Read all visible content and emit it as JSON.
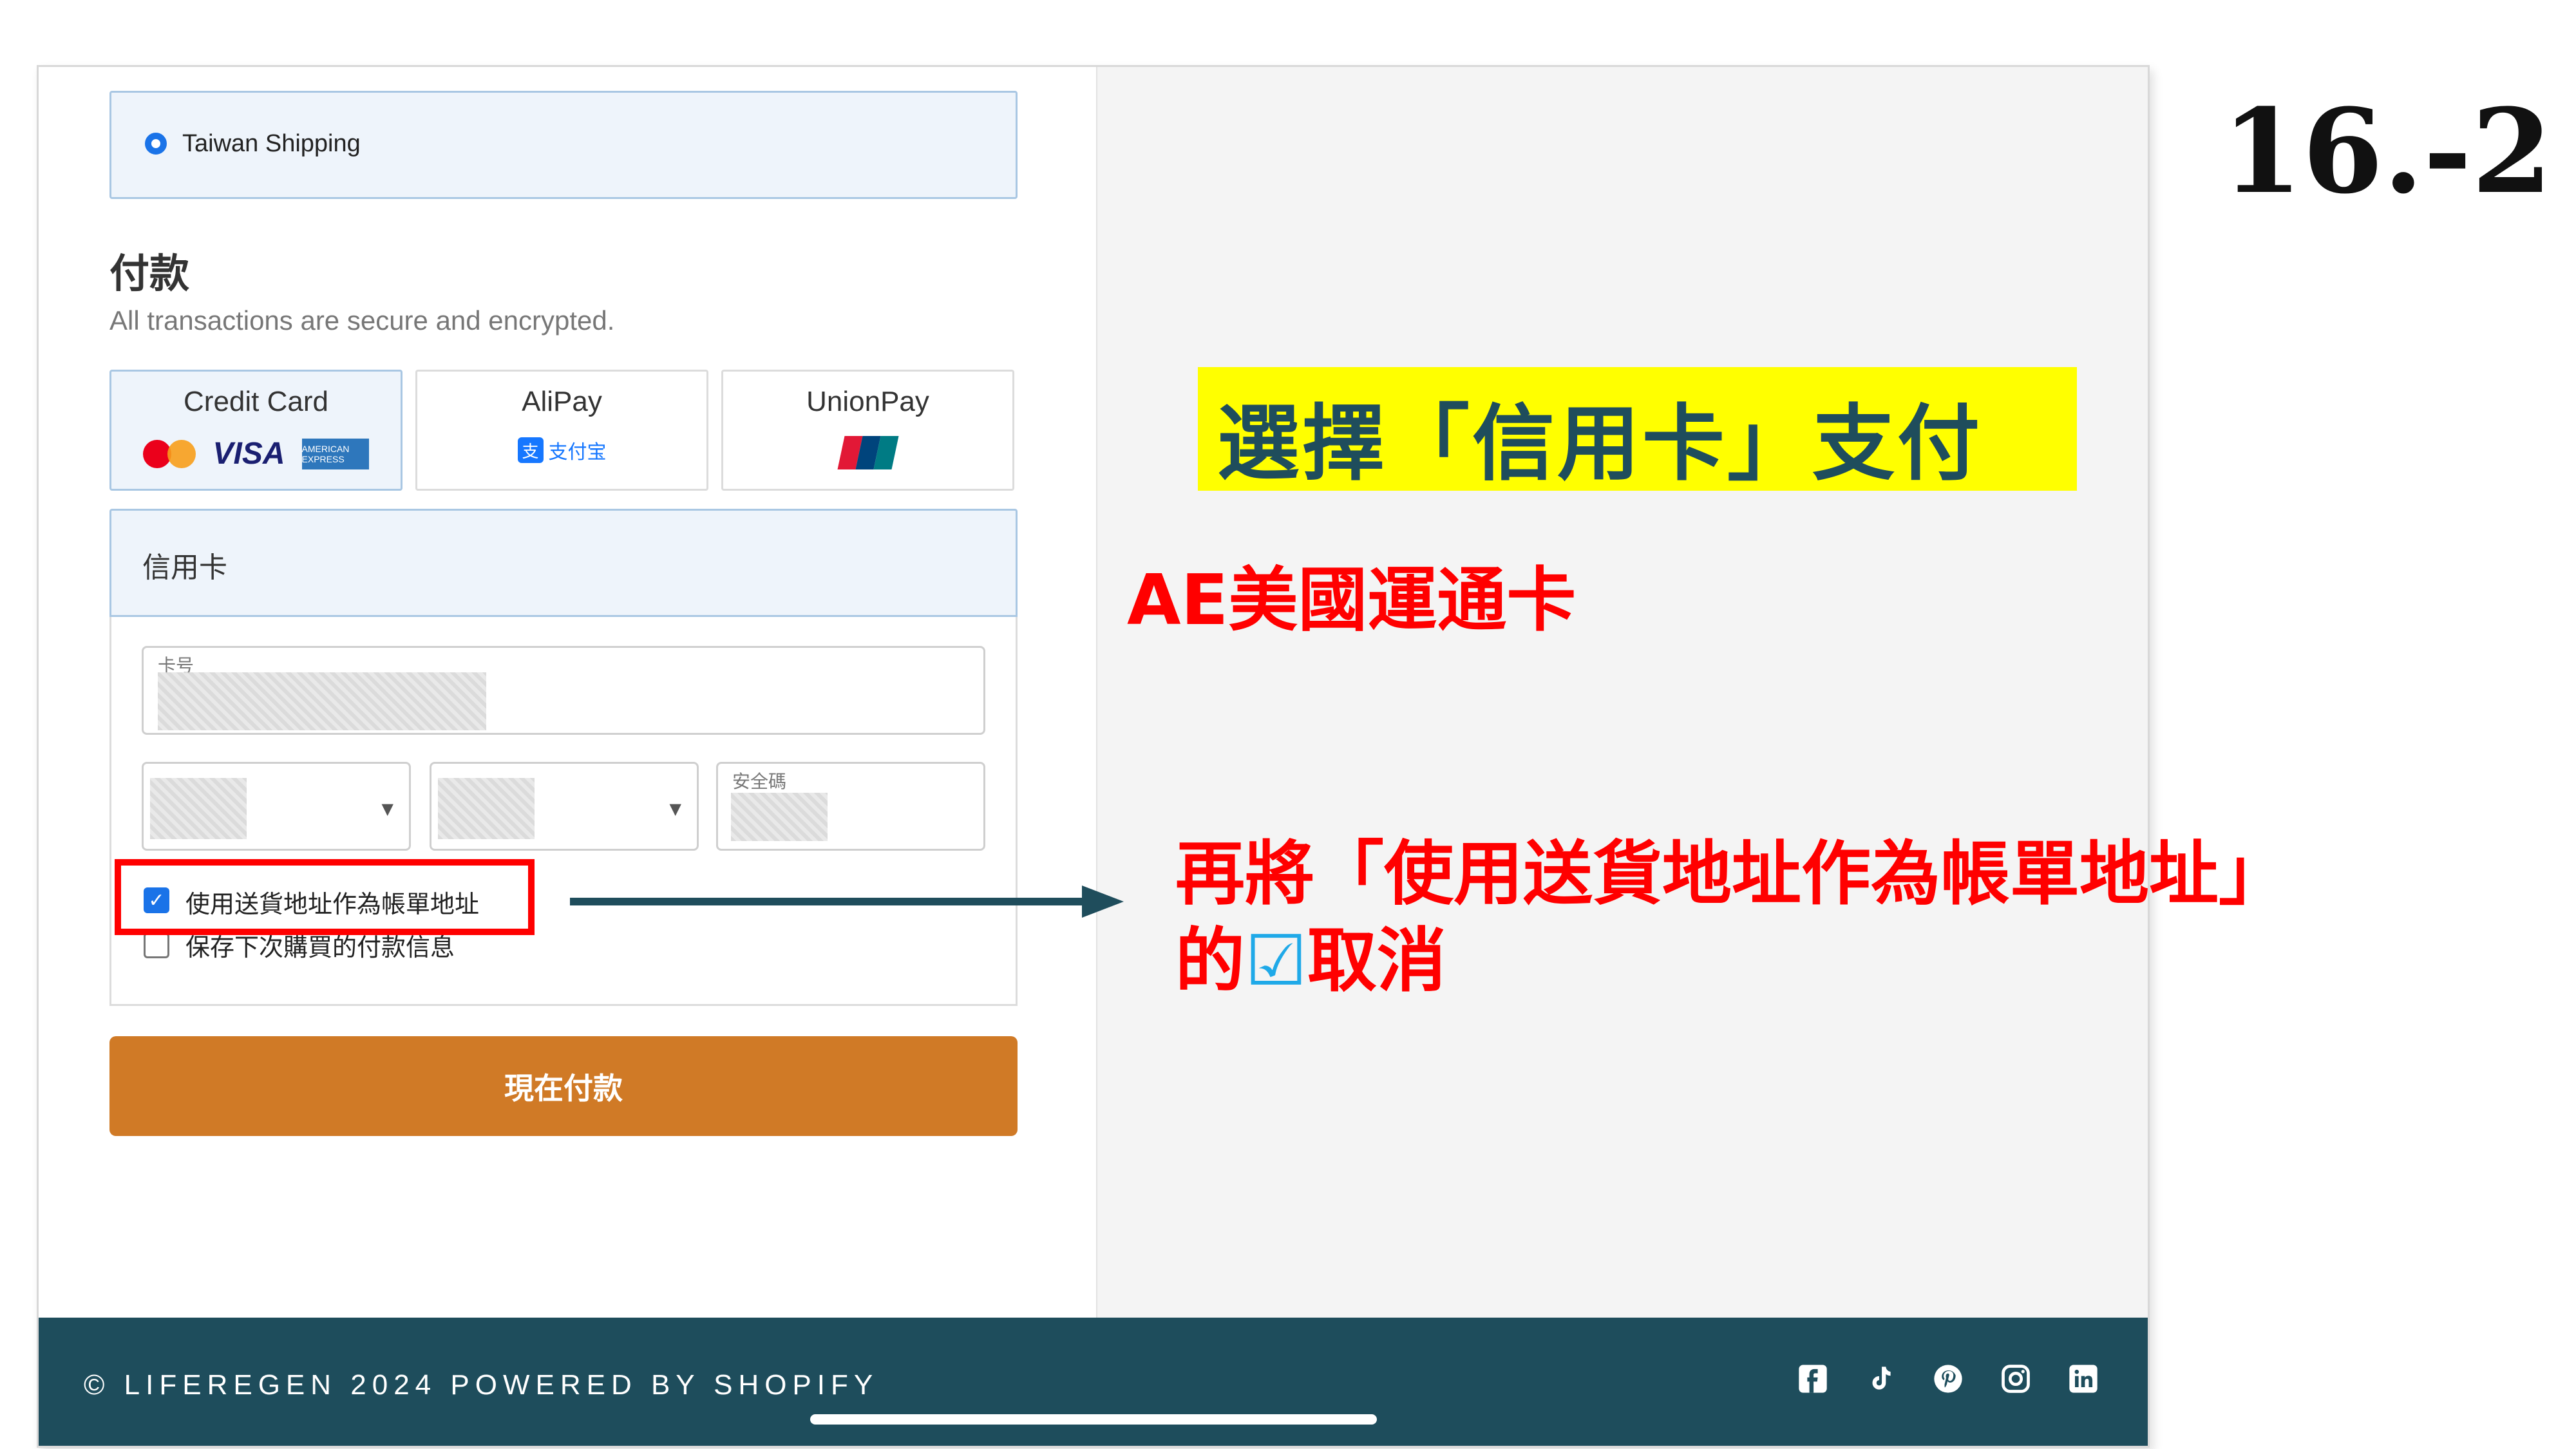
{
  "slide_number": "16.-2",
  "shipping": {
    "option_label": "Taiwan Shipping"
  },
  "payment": {
    "title": "付款",
    "subtitle": "All transactions are secure and encrypted.",
    "methods": [
      {
        "label": "Credit Card",
        "selected": true
      },
      {
        "label": "AliPay",
        "selected": false
      },
      {
        "label": "UnionPay",
        "selected": false
      }
    ],
    "logos": {
      "visa": "VISA",
      "amex": "AMERICAN EXPRESS",
      "alipay": "支付宝",
      "alipay_sub": "ALIPAY",
      "mastercard": "MasterCard",
      "unionpay": "UnionPay 银联"
    }
  },
  "credit_card": {
    "header": "信用卡",
    "card_number_label": "卡号",
    "security_code_label": "安全碼",
    "checkbox_billing": {
      "label": "使用送貨地址作為帳單地址",
      "checked": true
    },
    "checkbox_save": {
      "label": "保存下次購買的付款信息",
      "checked": false
    }
  },
  "pay_button": "現在付款",
  "annotations": {
    "highlight": "選擇「信用卡」支付",
    "ae": "AE美國運通卡",
    "note_line1": "再將「使用送貨地址作為帳單地址」",
    "note_line2_prefix": "的",
    "note_line2_check": "☑",
    "note_line2_suffix": "取消"
  },
  "footer": {
    "text": "© LIFEREGEN 2024 POWERED BY SHOPIFY"
  },
  "icons": [
    "facebook-icon",
    "tiktok-icon",
    "pinterest-icon",
    "instagram-icon",
    "linkedin-icon"
  ],
  "colors": {
    "accent_blue": "#1a73e8",
    "pay_button": "#d07a26",
    "footer_bg": "#1e4d5c",
    "annotation_red": "#ff0000",
    "highlight_yellow": "#ffff00"
  }
}
